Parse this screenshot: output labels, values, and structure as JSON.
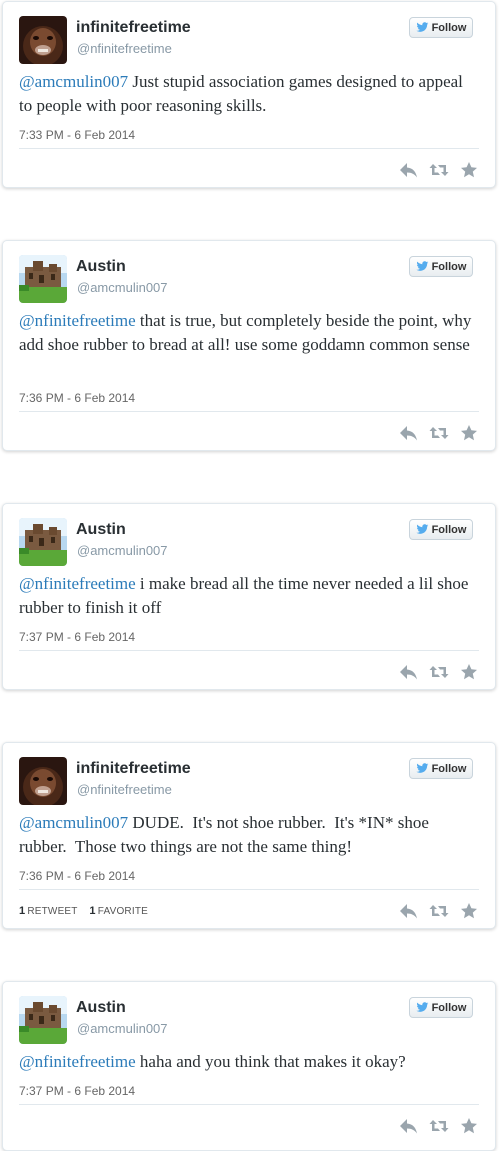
{
  "follow_label": "Follow",
  "tweets": [
    {
      "name": "infinitefreetime",
      "handle": "@nfinitefreetime",
      "mention": "@amcmulin007",
      "text": " Just stupid association games designed to appeal to people with poor reasoning skills.",
      "timestamp": "7:33 PM - 6 Feb 2014",
      "avatar": "gorilla"
    },
    {
      "name": "Austin",
      "handle": "@amcmulin007",
      "mention": "@nfinitefreetime",
      "text": " that is true, but completely beside the point, why add shoe rubber to bread at all! use some goddamn common sense",
      "timestamp": "7:36 PM - 6 Feb 2014",
      "avatar": "castle"
    },
    {
      "name": "Austin",
      "handle": "@amcmulin007",
      "mention": "@nfinitefreetime",
      "text": " i make bread all the time never needed a lil shoe rubber to finish it off",
      "timestamp": "7:37 PM - 6 Feb 2014",
      "avatar": "castle"
    },
    {
      "name": "infinitefreetime",
      "handle": "@nfinitefreetime",
      "mention": "@amcmulin007",
      "text": " DUDE.  It's not shoe rubber.  It's *IN* shoe rubber.  Those two things are not the same thing!",
      "timestamp": "7:36 PM - 6 Feb 2014",
      "avatar": "gorilla",
      "retweet_count": "1",
      "retweet_label": "RETWEET",
      "favorite_count": "1",
      "favorite_label": "FAVORITE"
    },
    {
      "name": "Austin",
      "handle": "@amcmulin007",
      "mention": "@nfinitefreetime",
      "text": " haha and you think that makes it okay?",
      "timestamp": "7:37 PM - 6 Feb 2014",
      "avatar": "castle"
    }
  ],
  "icons": {
    "action_icons": [
      "reply-icon",
      "retweet-icon",
      "favorite-icon"
    ],
    "follow_icon": "twitter-bird-icon"
  },
  "colors": {
    "mention": "#2b7bb9",
    "twitter_blue": "#55acee",
    "muted": "#8899a6"
  }
}
